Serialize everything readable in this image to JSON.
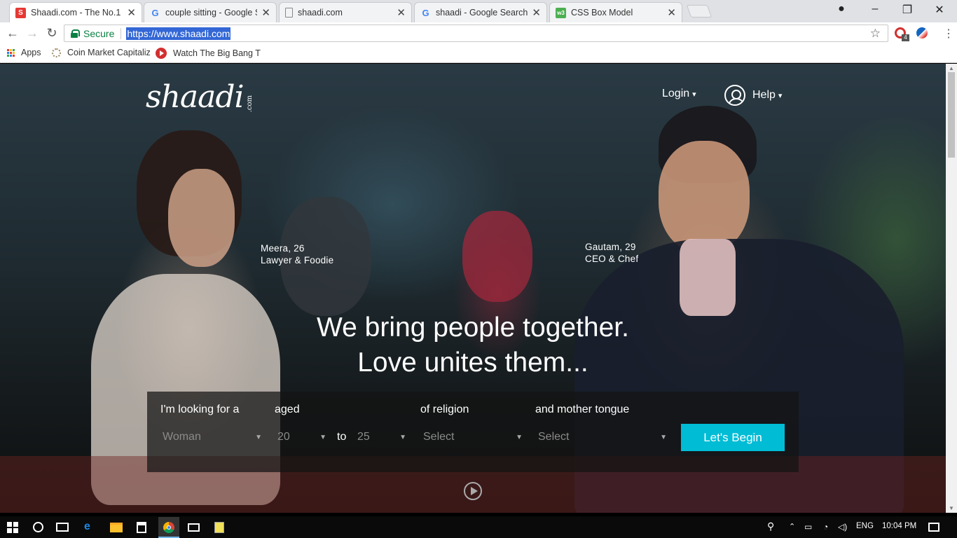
{
  "browser": {
    "tabs": [
      {
        "title": "Shaadi.com - The No.1 S",
        "favicon": "shaadi-favicon",
        "active": true
      },
      {
        "title": "couple sitting - Google S",
        "favicon": "google-favicon",
        "active": false
      },
      {
        "title": "shaadi.com",
        "favicon": "page-favicon",
        "active": false
      },
      {
        "title": "shaadi - Google Search",
        "favicon": "google-favicon",
        "active": false
      },
      {
        "title": "CSS Box Model",
        "favicon": "w3-favicon",
        "active": false
      }
    ],
    "address": {
      "secure_label": "Secure",
      "url": "https://www.shaadi.com"
    },
    "extension_badge": "4",
    "bookmarks": [
      {
        "label": "Apps",
        "icon": "apps-grid-icon"
      },
      {
        "label": "Coin Market Capitaliz",
        "icon": "coin-icon"
      },
      {
        "label": "Watch The Big Bang T",
        "icon": "play-red-icon"
      }
    ]
  },
  "page": {
    "logo": {
      "main": "shaadi",
      "suffix": ".com"
    },
    "nav": {
      "login": "Login",
      "help": "Help"
    },
    "captions": {
      "left": {
        "name": "Meera, 26",
        "role": "Lawyer & Foodie"
      },
      "right": {
        "name": "Gautam, 29",
        "role": "CEO & Chef"
      }
    },
    "headline": {
      "line1": "We bring people together.",
      "line2": "Love unites them..."
    },
    "search": {
      "looking_label": "I'm looking for a",
      "aged_label": "aged",
      "religion_label": "of religion",
      "tongue_label": "and mother tongue",
      "gender_value": "Woman",
      "age_from": "20",
      "to_label": "to",
      "age_to": "25",
      "religion_value": "Select",
      "tongue_value": "Select",
      "begin_label": "Let's Begin"
    }
  },
  "taskbar": {
    "lang": "ENG",
    "time": "10:04 PM"
  },
  "colors": {
    "accent": "#00bcd5",
    "secure": "#0b8043",
    "selection": "#3367d6"
  }
}
